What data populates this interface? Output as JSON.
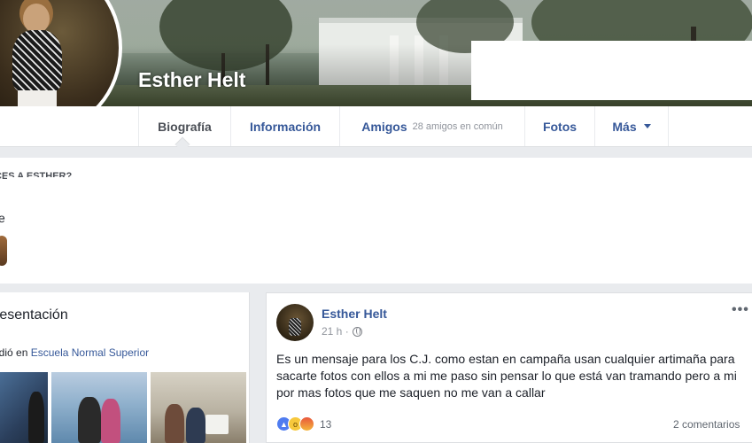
{
  "profile": {
    "name": "Esther Helt"
  },
  "tabs": [
    {
      "label": "Biografía",
      "sub": "",
      "active": true
    },
    {
      "label": "Información",
      "sub": ""
    },
    {
      "label": "Amigos",
      "sub": "28 amigos en común"
    },
    {
      "label": "Fotos",
      "sub": ""
    },
    {
      "label": "Más",
      "sub": "",
      "icon": "caret-down-icon"
    }
  ],
  "pymk": {
    "title": "CES A ESTHER?",
    "fragment": "e"
  },
  "intro": {
    "title": "resentación",
    "studied_prefix": "udió en",
    "school_link": "Escuela Normal Superior"
  },
  "post": {
    "author": "Esther Helt",
    "time": "21 h ·",
    "text": "Es un mensaje para los C.J. como estan en campaña usan cualquier artimaña para sacarte fotos con ellos a mi me paso sin pensar lo que está van tramando pero a mi por mas fotos que me saquen no me van a callar",
    "reaction_count": "13",
    "comments": "2 comentarios",
    "more": "•••"
  },
  "colors": {
    "link": "#365899",
    "background": "#e9ebee"
  }
}
